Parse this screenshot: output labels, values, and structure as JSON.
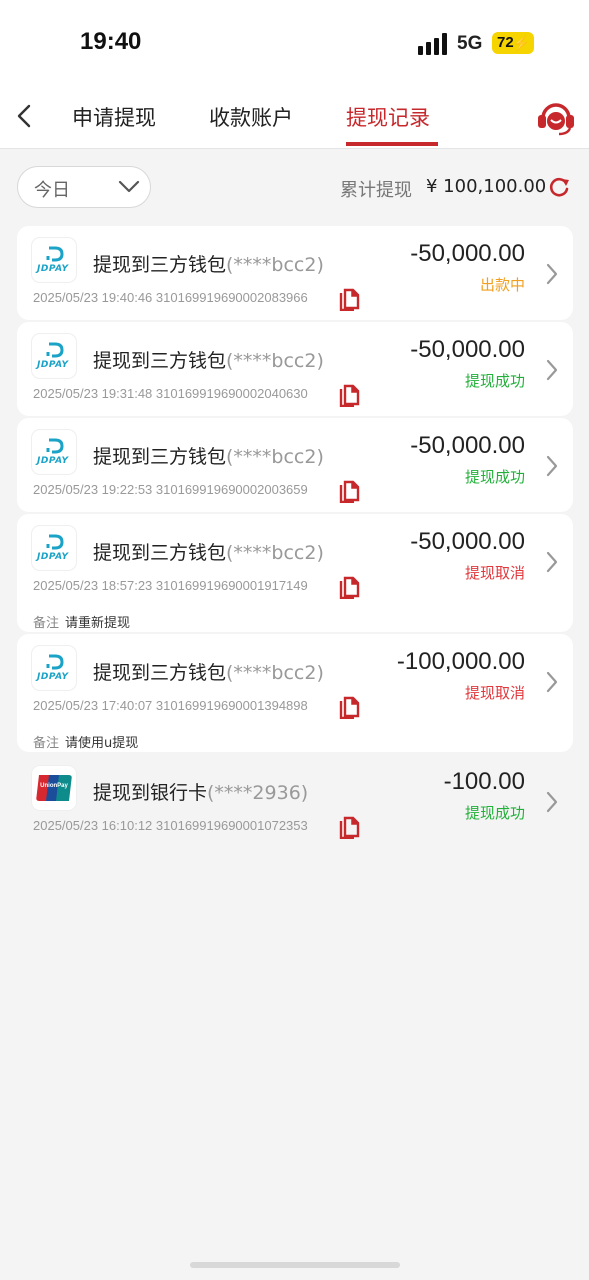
{
  "status_bar": {
    "time": "19:40",
    "network": "5G",
    "battery": "72"
  },
  "nav": {
    "tabs": [
      {
        "label": "申请提现",
        "active": false
      },
      {
        "label": "收款账户",
        "active": false
      },
      {
        "label": "提现记录",
        "active": true
      }
    ],
    "accent_color": "#c6282c"
  },
  "filter": {
    "date_value": "今日",
    "total_label": "累计提现",
    "total_value": "¥ 100,100.00"
  },
  "records": [
    {
      "channel": "JDPAY",
      "logo": "jdpay-logo",
      "title": "提现到三方钱包",
      "account": "(****bcc2)",
      "datetime": "2025/05/23 19:40:46",
      "order_no": "3101699196900020839​66",
      "amount": "-50,000.00",
      "status": "出款中",
      "status_color": "#f0a020"
    },
    {
      "channel": "JDPAY",
      "logo": "jdpay-logo",
      "title": "提现到三方钱包",
      "account": "(****bcc2)",
      "datetime": "2025/05/23 19:31:48",
      "order_no": "310169919690002040630",
      "amount": "-50,000.00",
      "status": "提现成功",
      "status_color": "#22b03a"
    },
    {
      "channel": "JDPAY",
      "logo": "jdpay-logo",
      "title": "提现到三方钱包",
      "account": "(****bcc2)",
      "datetime": "2025/05/23 19:22:53",
      "order_no": "310169919690002003659",
      "amount": "-50,000.00",
      "status": "提现成功",
      "status_color": "#22b03a"
    },
    {
      "channel": "JDPAY",
      "logo": "jdpay-logo",
      "title": "提现到三方钱包",
      "account": "(****bcc2)",
      "datetime": "2025/05/23 18:57:23",
      "order_no": "310169919690001917149",
      "amount": "-50,000.00",
      "status": "提现取消",
      "status_color": "#e0383c",
      "remark_label": "备注",
      "remark": "请重新提现"
    },
    {
      "channel": "JDPAY",
      "logo": "jdpay-logo",
      "title": "提现到三方钱包",
      "account": "(****bcc2)",
      "datetime": "2025/05/23 17:40:07",
      "order_no": "310169919690001394898",
      "amount": "-100,000.00",
      "status": "提现取消",
      "status_color": "#e0383c",
      "remark_label": "备注",
      "remark": "请使用u提现"
    },
    {
      "channel": "UnionPay",
      "logo": "unionpay-logo",
      "title": "提现到银行卡",
      "account": "(****2936)",
      "datetime": "2025/05/23 16:10:12",
      "order_no": "310169919690001072353",
      "amount": "-100.00",
      "status": "提现成功",
      "status_color": "#22b03a"
    }
  ]
}
